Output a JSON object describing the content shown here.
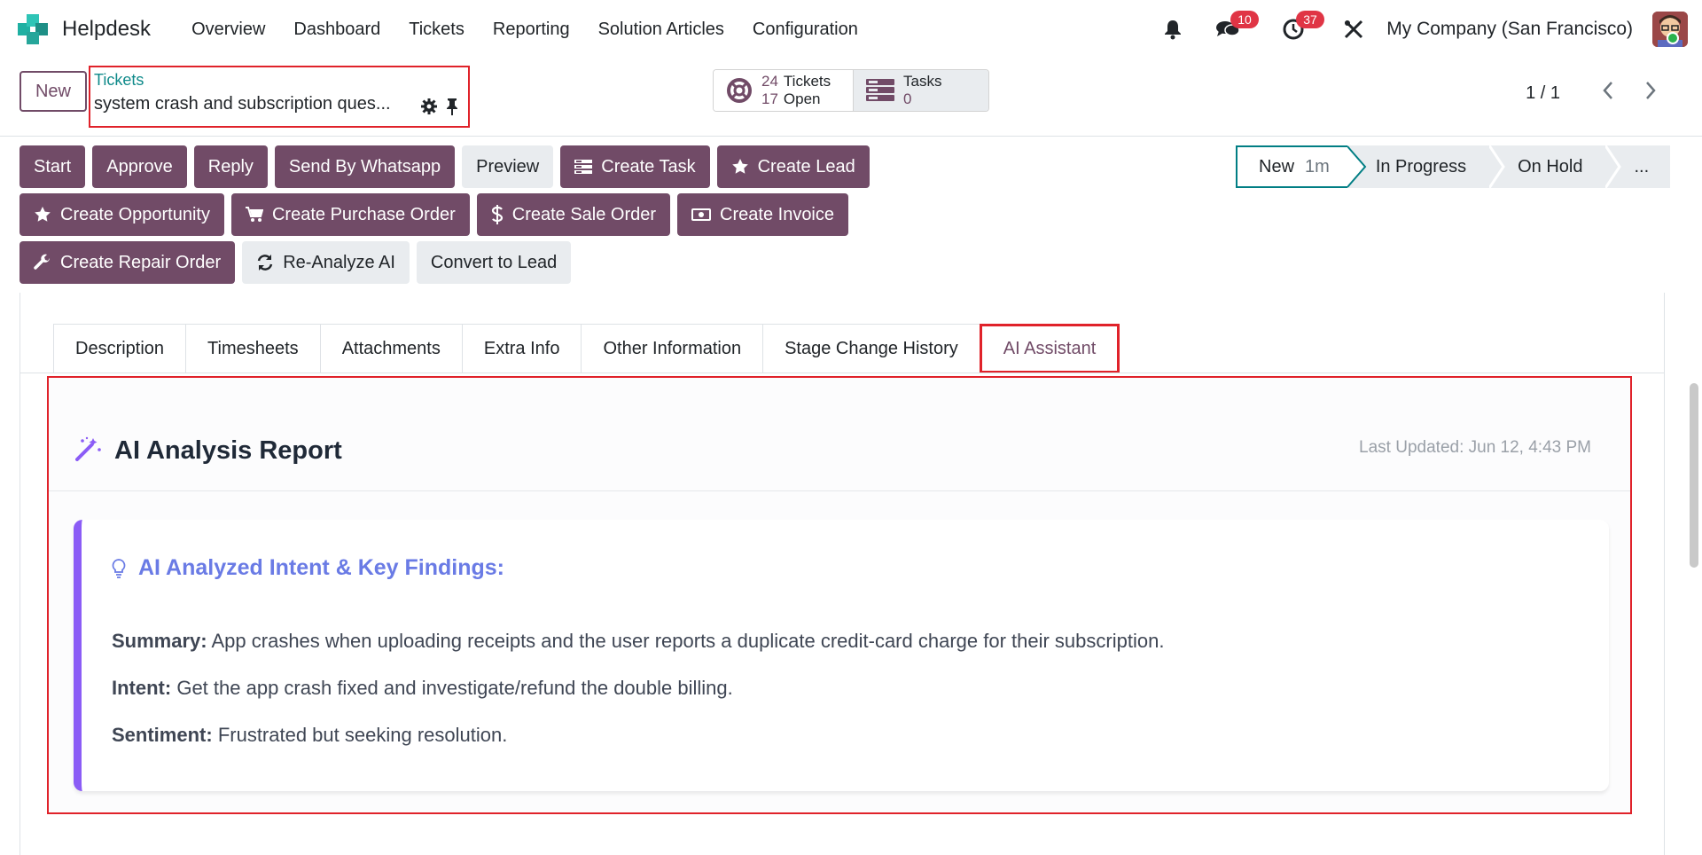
{
  "navbar": {
    "app_name": "Helpdesk",
    "menu": [
      "Overview",
      "Dashboard",
      "Tickets",
      "Reporting",
      "Solution Articles",
      "Configuration"
    ],
    "messages_count": "10",
    "activities_count": "37",
    "company": "My Company (San Francisco)"
  },
  "control": {
    "new_label": "New",
    "breadcrumb_parent": "Tickets",
    "record_title": "system crash and subscription ques...",
    "tickets_count": "24",
    "tickets_label": "Tickets",
    "open_count": "17",
    "open_label": "Open",
    "tasks_label": "Tasks",
    "tasks_count": "0",
    "pager": "1 / 1"
  },
  "actions": {
    "row1": [
      "Start",
      "Approve",
      "Reply",
      "Send By Whatsapp",
      "Preview",
      "Create Task",
      "Create Lead"
    ],
    "row2": [
      "Create Opportunity",
      "Create Purchase Order",
      "Create Sale Order",
      "Create Invoice"
    ],
    "row3": [
      "Create Repair Order",
      "Re-Analyze AI",
      "Convert to Lead"
    ]
  },
  "status": {
    "current": "New",
    "current_time": "1m",
    "stages": [
      "In Progress",
      "On Hold"
    ],
    "more": "..."
  },
  "tabs": [
    "Description",
    "Timesheets",
    "Attachments",
    "Extra Info",
    "Other Information",
    "Stage Change History",
    "AI Assistant"
  ],
  "report": {
    "title": "AI Analysis Report",
    "updated": "Last Updated: Jun 12, 4:43 PM",
    "card_title": "AI Analyzed Intent & Key Findings:",
    "summary_label": "Summary:",
    "summary": "App crashes when uploading receipts and the user reports a duplicate credit-card charge for their subscription.",
    "intent_label": "Intent:",
    "intent": "Get the app crash fixed and investigate/refund the double billing.",
    "sentiment_label": "Sentiment:",
    "sentiment": "Frustrated but seeking resolution."
  },
  "colors": {
    "brand": "#714b67",
    "teal": "#017e84",
    "highlight": "#e0222a",
    "accent_purple": "#8b5cf6",
    "card_title": "#6a7be5"
  }
}
